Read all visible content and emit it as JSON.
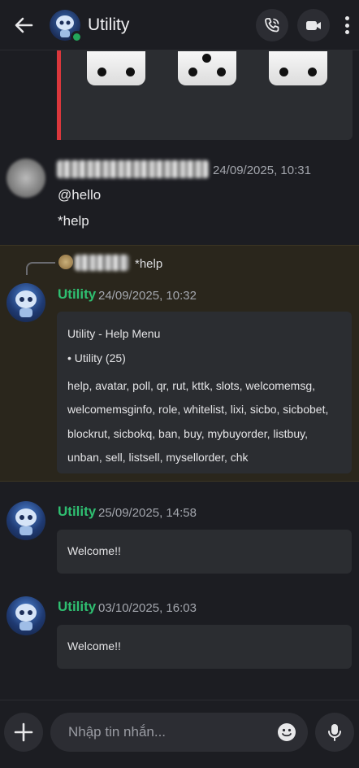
{
  "header": {
    "title": "Utility",
    "icons": [
      "back-arrow-icon",
      "phone-icon",
      "video-camera-icon",
      "more-vertical-icon"
    ],
    "status_color": "#23a55a"
  },
  "dice": {
    "faces": [
      2,
      3,
      2
    ]
  },
  "messages": [
    {
      "author": "(blurred)",
      "timestamp": "24/09/2025, 10:31",
      "lines": [
        "@hello",
        "*help"
      ]
    },
    {
      "reply_to_text": "*help",
      "author": "Utility",
      "timestamp": "24/09/2025, 10:32",
      "embed": {
        "title": "Utility - Help Menu",
        "subtitle": "• Utility (25)",
        "commands": "help, avatar, poll, qr, rut, kttk, slots, welcomemsg, welcomemsginfo, role, whitelist, lixi, sicbo, sicbobet, blockrut, sicbokq, ban, buy, mybuyorder, listbuy, unban, sell, listsell, mysellorder, chk"
      }
    },
    {
      "author": "Utility",
      "timestamp": "25/09/2025, 14:58",
      "embed_text": "Welcome!!"
    },
    {
      "author": "Utility",
      "timestamp": "03/10/2025, 16:03",
      "embed_text": "Welcome!!"
    }
  ],
  "composer": {
    "placeholder": "Nhập tin nhắn...",
    "icons": [
      "plus-icon",
      "emoji-icon",
      "microphone-icon"
    ]
  },
  "colors": {
    "background": "#1c1d22",
    "embed": "#2b2d31",
    "bot_name": "#2fbf71",
    "highlight": "#2a261c",
    "dice_border": "#da373c"
  }
}
